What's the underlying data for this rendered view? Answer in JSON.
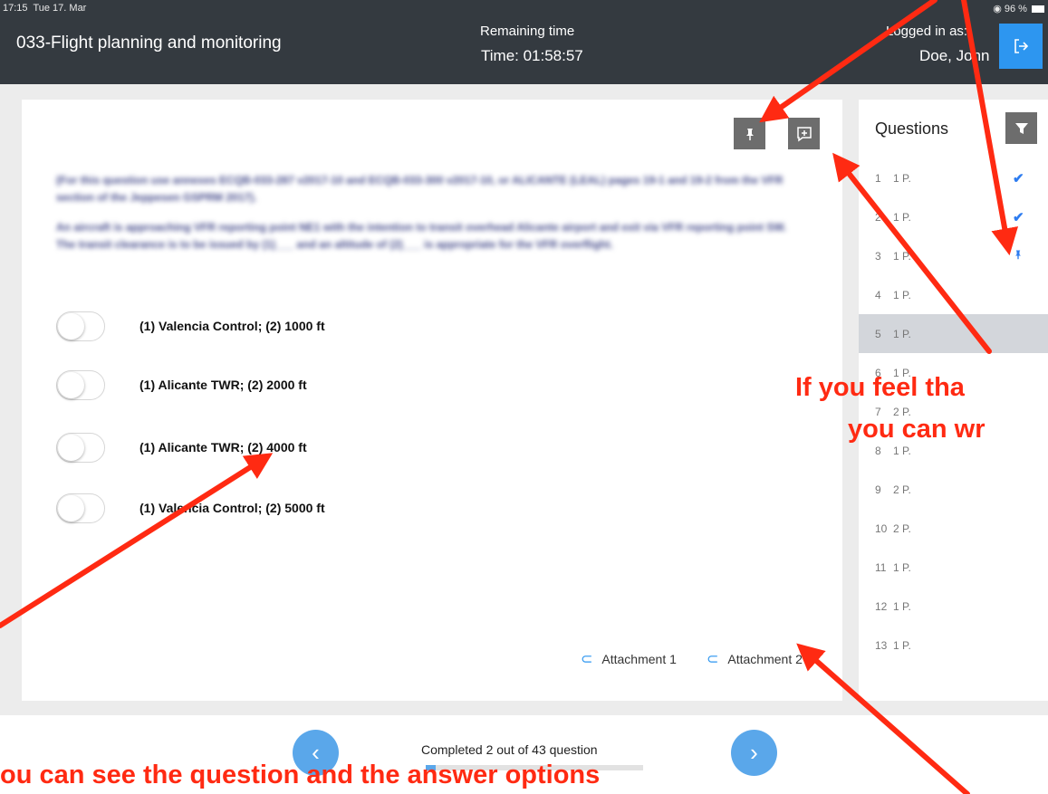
{
  "status_bar": {
    "time": "17:15",
    "date": "Tue 17. Mar",
    "battery": "96 %"
  },
  "header": {
    "title": "033-Flight planning and monitoring",
    "timer_label": "Remaining time",
    "timer_value": "Time: 01:58:57",
    "login_label": "Logged in as:",
    "login_name": "Doe, John",
    "logout_icon": "logout-icon"
  },
  "question": {
    "paragraph_1": "(For this question use annexes ECQB-033-287 v2017-10 and ECQB-033-300 v2017-10, or ALICANTE (LEAL) pages 19-1 and 19-2 from the VFR section of the Jeppesen GSPRM 2017).",
    "paragraph_2": "An aircraft is approaching VFR reporting point NE1 with the intention to transit overhead Alicante airport and exit via VFR reporting point SW. The transit clearance is to be issued by (1)___ and an altitude of (2)___ is appropriate for the VFR overflight.",
    "options": [
      {
        "label": "(1) Valencia Control; (2) 1000 ft"
      },
      {
        "label": "(1) Alicante TWR;  (2) 2000 ft"
      },
      {
        "label": "(1) Alicante TWR;  (2) 4000 ft"
      },
      {
        "label": "(1) Valencia Control; (2) 5000 ft"
      }
    ],
    "attachments": [
      "Attachment 1",
      "Attachment 2"
    ],
    "pin_icon": "pin-icon",
    "note_icon": "add-note-icon"
  },
  "sidebar": {
    "title": "Questions",
    "filter_icon": "filter-icon",
    "items": [
      {
        "num": "1",
        "points": "1 P.",
        "mark": "✔"
      },
      {
        "num": "2",
        "points": "1 P.",
        "mark": "✔"
      },
      {
        "num": "3",
        "points": "1 P.",
        "mark": "pin"
      },
      {
        "num": "4",
        "points": "1 P.",
        "mark": ""
      },
      {
        "num": "5",
        "points": "1 P.",
        "mark": ""
      },
      {
        "num": "6",
        "points": "1 P.",
        "mark": ""
      },
      {
        "num": "7",
        "points": "2 P.",
        "mark": ""
      },
      {
        "num": "8",
        "points": "1 P.",
        "mark": ""
      },
      {
        "num": "9",
        "points": "2 P.",
        "mark": ""
      },
      {
        "num": "10",
        "points": "2 P.",
        "mark": ""
      },
      {
        "num": "11",
        "points": "1 P.",
        "mark": ""
      },
      {
        "num": "12",
        "points": "1 P.",
        "mark": ""
      },
      {
        "num": "13",
        "points": "1 P.",
        "mark": ""
      }
    ],
    "active_index": 4
  },
  "footer": {
    "completed_text": "Completed 2 out of 43 question",
    "progress_fraction": 0.047,
    "prev_label": "‹",
    "next_label": "›"
  },
  "annotations": {
    "right_line_1": "If you feel tha",
    "right_line_2": "you can wr",
    "bottom": "ou can see the question and the answer options"
  },
  "colors": {
    "header_bg": "#343a40",
    "accent": "#2d96f0",
    "annotation": "#ff2a12"
  }
}
